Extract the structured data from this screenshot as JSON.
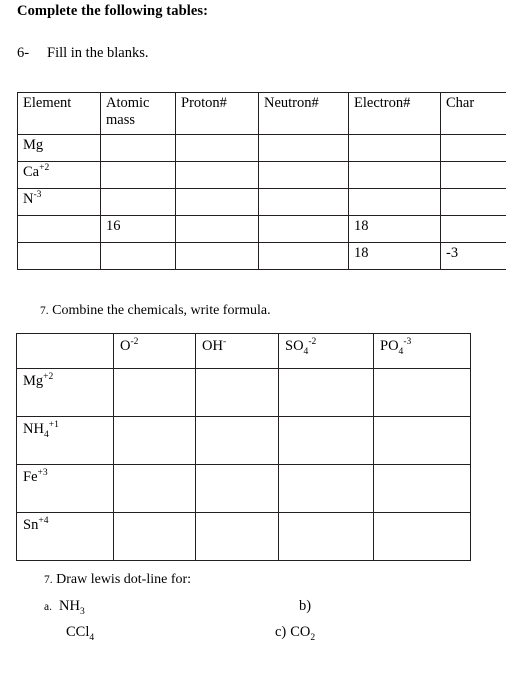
{
  "document": {
    "title": "Complete the following tables:"
  },
  "question6": {
    "number": "6-",
    "prompt": "Fill in the blanks.",
    "table": {
      "headers": [
        "Element",
        "Atomic mass",
        "Proton#",
        "Neutron#",
        "Electron#",
        "Char"
      ],
      "rows": [
        {
          "element_html": "Mg",
          "atomic_mass": "",
          "protons": "",
          "neutrons": "",
          "electrons": "",
          "charge": ""
        },
        {
          "element_html": "Ca<sup>+2</sup>",
          "atomic_mass": "",
          "protons": "",
          "neutrons": "",
          "electrons": "",
          "charge": ""
        },
        {
          "element_html": "N<sup>-3</sup>",
          "atomic_mass": "",
          "protons": "",
          "neutrons": "",
          "electrons": "",
          "charge": ""
        },
        {
          "element_html": "",
          "atomic_mass": "16",
          "protons": "",
          "neutrons": "",
          "electrons": "18",
          "charge": ""
        },
        {
          "element_html": "",
          "atomic_mass": "",
          "protons": "",
          "neutrons": "",
          "electrons": "18",
          "charge": "-3"
        }
      ]
    }
  },
  "question7a": {
    "number": "7.",
    "prompt": "Combine the chemicals, write formula.",
    "table": {
      "corner": "",
      "headers_html": [
        "O<sup>-2</sup>",
        "OH<sup>-</sup>",
        "SO<sub>4</sub><sup>-2</sup>",
        "PO<sub>4</sub><sup>-3</sup>"
      ],
      "row_labels_html": [
        "Mg<sup>+2</sup>",
        "NH<sub>4</sub><sup>+1</sup>",
        "Fe<sup>+3</sup>",
        "Sn<sup>+4</sup>"
      ],
      "cells": [
        [
          "",
          "",
          "",
          ""
        ],
        [
          "",
          "",
          "",
          ""
        ],
        [
          "",
          "",
          "",
          ""
        ],
        [
          "",
          "",
          "",
          ""
        ]
      ]
    }
  },
  "question7b": {
    "number": "7.",
    "prompt": "Draw lewis dot-line for:",
    "items": [
      {
        "label": "a.",
        "formula_html": "NH<sub>3</sub>"
      },
      {
        "label": "",
        "formula_html": "CCl<sub>4</sub>"
      },
      {
        "label": "b)",
        "formula_html": ""
      },
      {
        "label": "c)",
        "formula_html": "CO<sub>2</sub>"
      }
    ]
  }
}
